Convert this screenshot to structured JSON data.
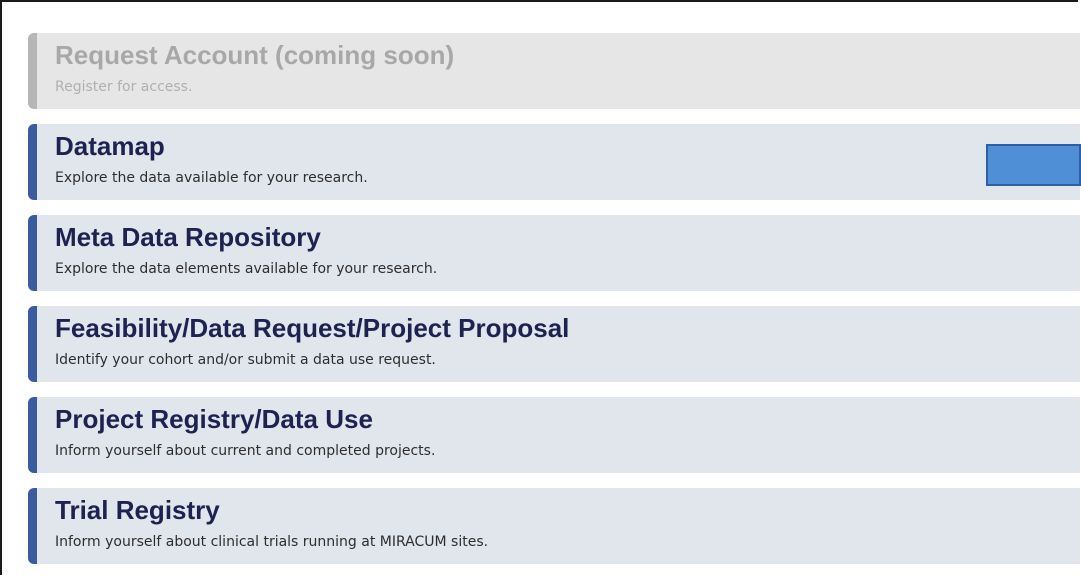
{
  "cards": [
    {
      "title": "Request Account (coming soon)",
      "description": "Register for access."
    },
    {
      "title": "Datamap",
      "description": "Explore the data available for your research."
    },
    {
      "title": "Meta Data Repository",
      "description": "Explore the data elements available for your research."
    },
    {
      "title": "Feasibility/Data Request/Project Proposal",
      "description": "Identify your cohort and/or submit a data use request."
    },
    {
      "title": "Project Registry/Data Use",
      "description": "Inform yourself about current and completed projects."
    },
    {
      "title": "Trial Registry",
      "description": "Inform yourself about clinical trials running at MIRACUM sites."
    }
  ],
  "colors": {
    "accent": "#3b5aa0",
    "disabled_accent": "#b6b6b6",
    "card_bg": "#e1e5ec",
    "title": "#1c2350",
    "side_tab": "#4f8fd6"
  }
}
